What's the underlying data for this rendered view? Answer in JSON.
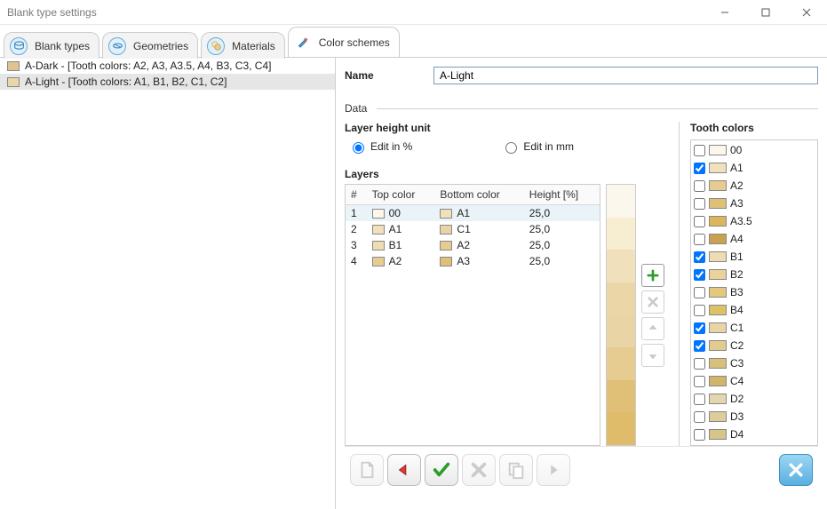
{
  "window": {
    "title": "Blank type settings"
  },
  "tabs": [
    {
      "label": "Blank types"
    },
    {
      "label": "Geometries"
    },
    {
      "label": "Materials"
    },
    {
      "label": "Color schemes"
    }
  ],
  "schemes": [
    {
      "label": "A-Dark - [Tooth colors: A2, A3, A3.5, A4, B3, C3, C4]",
      "swatch": "#e0c38f",
      "selected": false
    },
    {
      "label": "A-Light - [Tooth colors: A1, B1, B2, C1, C2]",
      "swatch": "#e9d6a8",
      "selected": true
    }
  ],
  "form": {
    "name_label": "Name",
    "name_value": "A-Light",
    "data_legend": "Data",
    "lh_label": "Layer height unit",
    "radio_pct": "Edit in %",
    "radio_mm": "Edit in mm",
    "radio_selected": "pct",
    "layers_label": "Layers",
    "layer_columns": {
      "num": "#",
      "top": "Top color",
      "bottom": "Bottom color",
      "height": "Height [%]"
    },
    "tooth_label": "Tooth colors"
  },
  "layers": [
    {
      "n": "1",
      "top": {
        "name": "00",
        "color": "#fcf6eb"
      },
      "bottom": {
        "name": "A1",
        "color": "#f0e0bc"
      },
      "height": "25,0"
    },
    {
      "n": "2",
      "top": {
        "name": "A1",
        "color": "#f0e0bc"
      },
      "bottom": {
        "name": "C1",
        "color": "#e8d4a4"
      },
      "height": "25,0"
    },
    {
      "n": "3",
      "top": {
        "name": "B1",
        "color": "#eeddb4"
      },
      "bottom": {
        "name": "A2",
        "color": "#e6cc90"
      },
      "height": "25,0"
    },
    {
      "n": "4",
      "top": {
        "name": "A2",
        "color": "#e6cc90"
      },
      "bottom": {
        "name": "A3",
        "color": "#e0c076"
      },
      "height": "25,0"
    }
  ],
  "preview": [
    "#fcf7ec",
    "#f7edd1",
    "#f0e0bc",
    "#ead6a7",
    "#e8d4a4",
    "#e6cc90",
    "#e0c076",
    "#dfbc6a"
  ],
  "toothColors": [
    {
      "name": "00",
      "color": "#fcf6eb",
      "checked": false
    },
    {
      "name": "A1",
      "color": "#f0e0bc",
      "checked": true
    },
    {
      "name": "A2",
      "color": "#e6cc90",
      "checked": false
    },
    {
      "name": "A3",
      "color": "#e0c076",
      "checked": false
    },
    {
      "name": "A3.5",
      "color": "#dcb65c",
      "checked": false
    },
    {
      "name": "A4",
      "color": "#caa150",
      "checked": false
    },
    {
      "name": "B1",
      "color": "#eeddb4",
      "checked": true
    },
    {
      "name": "B2",
      "color": "#ead29a",
      "checked": true
    },
    {
      "name": "B3",
      "color": "#e3c97e",
      "checked": false
    },
    {
      "name": "B4",
      "color": "#dcc166",
      "checked": false
    },
    {
      "name": "C1",
      "color": "#e8d4a4",
      "checked": true
    },
    {
      "name": "C2",
      "color": "#e2cb8e",
      "checked": true
    },
    {
      "name": "C3",
      "color": "#d8c07a",
      "checked": false
    },
    {
      "name": "C4",
      "color": "#d0b56a",
      "checked": false
    },
    {
      "name": "D2",
      "color": "#e4d7b0",
      "checked": false
    },
    {
      "name": "D3",
      "color": "#ddcd9c",
      "checked": false
    },
    {
      "name": "D4",
      "color": "#d6c48a",
      "checked": false
    }
  ]
}
